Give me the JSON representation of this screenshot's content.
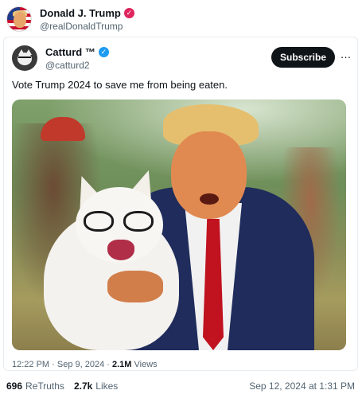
{
  "outer_post": {
    "name": "Donald J. Trump",
    "handle": "@realDonaldTrump",
    "verified_color": "#e0245e",
    "retruths_count": "696",
    "retruths_label": "ReTruths",
    "likes_count": "2.7k",
    "likes_label": "Likes",
    "timestamp": "Sep 12, 2024 at 1:31 PM"
  },
  "tweet": {
    "name": "Catturd ™",
    "handle": "@catturd2",
    "verified_color": "#1d9bf0",
    "subscribe_label": "Subscribe",
    "more_icon": "…",
    "text": "Vote Trump 2024 to save me from being eaten.",
    "time": "12:22 PM · Sep 9, 2024 · ",
    "views_count": "2.1M",
    "views_label": "Views"
  }
}
